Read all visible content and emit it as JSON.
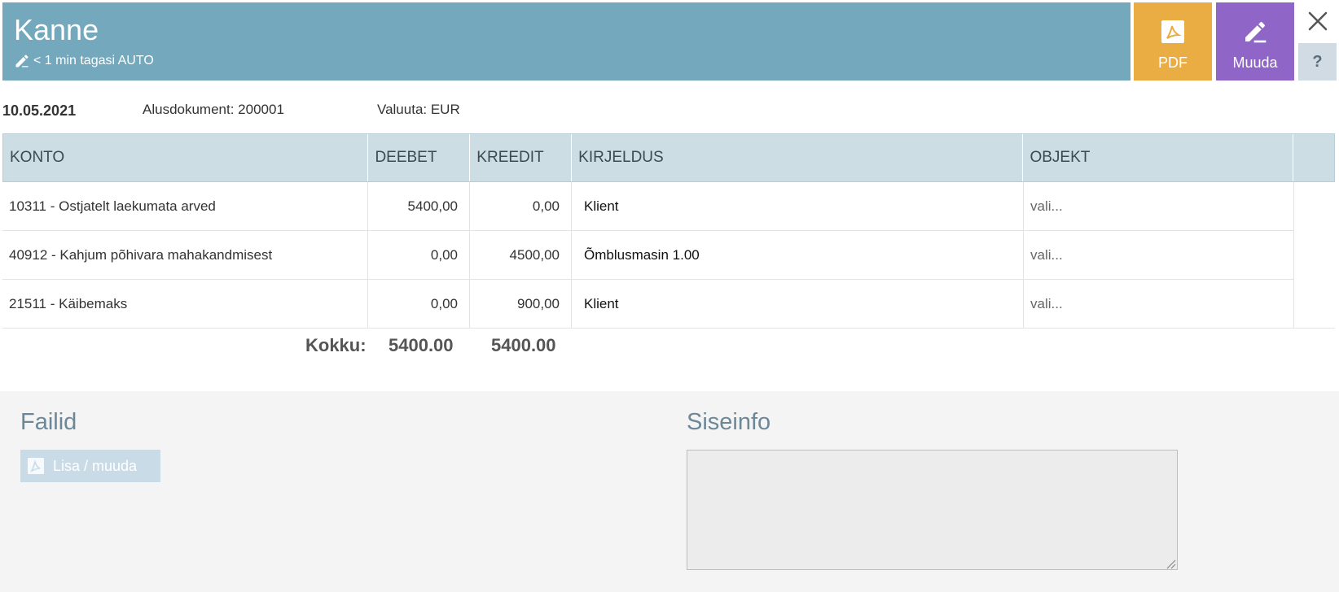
{
  "header": {
    "title": "Kanne",
    "subtitle": "< 1 min tagasi AUTO",
    "pdf_label": "PDF",
    "edit_label": "Muuda",
    "help_label": "?",
    "colors": {
      "header": "#73a8bd",
      "pdf": "#e9ad44",
      "edit": "#8f66c7"
    }
  },
  "info": {
    "date": "10.05.2021",
    "document": "Alusdokument: 200001",
    "currency": "Valuuta: EUR"
  },
  "table": {
    "headers": [
      "KONTO",
      "DEEBET",
      "KREEDIT",
      "KIRJELDUS",
      "OBJEKT"
    ],
    "rows": [
      {
        "account": "10311 - Ostjatelt laekumata arved",
        "debit": "5400,00",
        "credit": "0,00",
        "description": "Klient",
        "object": "vali..."
      },
      {
        "account": "40912 - Kahjum põhivara mahakandmisest",
        "debit": "0,00",
        "credit": "4500,00",
        "description": "Õmblusmasin 1.00",
        "object": "vali..."
      },
      {
        "account": "21511 - Käibemaks",
        "debit": "0,00",
        "credit": "900,00",
        "description": "Klient",
        "object": "vali..."
      }
    ],
    "totals": {
      "label": "Kokku:",
      "debit": "5400.00",
      "credit": "5400.00"
    }
  },
  "files": {
    "title": "Failid",
    "add_label": "Lisa / muuda"
  },
  "internal": {
    "title": "Siseinfo",
    "value": ""
  }
}
